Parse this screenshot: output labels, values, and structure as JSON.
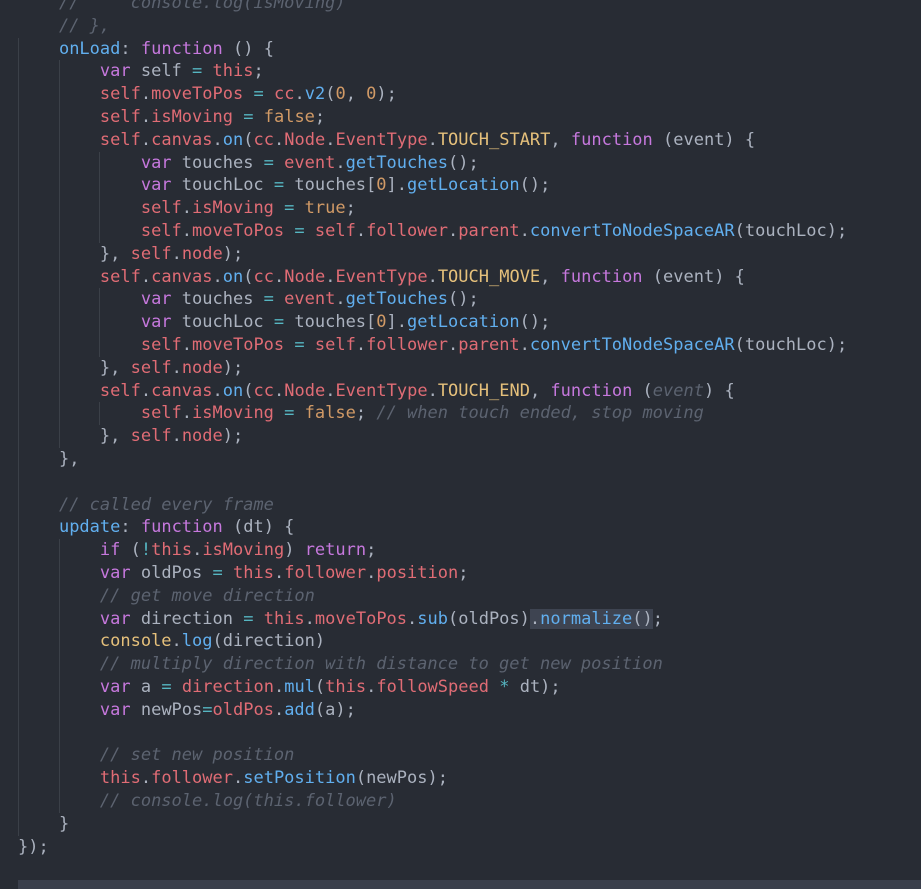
{
  "editor": {
    "lines": [
      [
        [
          "cmt",
          "//     console.log(isMoving)"
        ]
      ],
      [
        [
          "cmt",
          "// },"
        ]
      ],
      [
        [
          "fn",
          "onLoad"
        ],
        [
          "p",
          ": "
        ],
        [
          "kw",
          "function"
        ],
        [
          "p",
          " () {"
        ]
      ],
      [
        [
          "kw",
          "var"
        ],
        [
          "p",
          " self "
        ],
        [
          "op",
          "="
        ],
        [
          "p",
          " "
        ],
        [
          "var",
          "this"
        ],
        [
          "p",
          ";"
        ]
      ],
      [
        [
          "var",
          "self"
        ],
        [
          "p",
          "."
        ],
        [
          "var",
          "moveToPos"
        ],
        [
          "p",
          " "
        ],
        [
          "op",
          "="
        ],
        [
          "p",
          " "
        ],
        [
          "var",
          "cc"
        ],
        [
          "p",
          "."
        ],
        [
          "fn",
          "v2"
        ],
        [
          "p",
          "("
        ],
        [
          "num",
          "0"
        ],
        [
          "p",
          ", "
        ],
        [
          "num",
          "0"
        ],
        [
          "p",
          ");"
        ]
      ],
      [
        [
          "var",
          "self"
        ],
        [
          "p",
          "."
        ],
        [
          "var",
          "isMoving"
        ],
        [
          "p",
          " "
        ],
        [
          "op",
          "="
        ],
        [
          "p",
          " "
        ],
        [
          "num",
          "false"
        ],
        [
          "p",
          ";"
        ]
      ],
      [
        [
          "var",
          "self"
        ],
        [
          "p",
          "."
        ],
        [
          "var",
          "canvas"
        ],
        [
          "p",
          "."
        ],
        [
          "fn",
          "on"
        ],
        [
          "p",
          "("
        ],
        [
          "var",
          "cc"
        ],
        [
          "p",
          "."
        ],
        [
          "var",
          "Node"
        ],
        [
          "p",
          "."
        ],
        [
          "var",
          "EventType"
        ],
        [
          "p",
          "."
        ],
        [
          "obj",
          "TOUCH_START"
        ],
        [
          "p",
          ", "
        ],
        [
          "kw",
          "function"
        ],
        [
          "p",
          " (event) {"
        ]
      ],
      [
        [
          "kw",
          "var"
        ],
        [
          "p",
          " touches "
        ],
        [
          "op",
          "="
        ],
        [
          "p",
          " "
        ],
        [
          "var",
          "event"
        ],
        [
          "p",
          "."
        ],
        [
          "fn",
          "getTouches"
        ],
        [
          "p",
          "();"
        ]
      ],
      [
        [
          "kw",
          "var"
        ],
        [
          "p",
          " touchLoc "
        ],
        [
          "op",
          "="
        ],
        [
          "p",
          " touches["
        ],
        [
          "num",
          "0"
        ],
        [
          "p",
          "]."
        ],
        [
          "fn",
          "getLocation"
        ],
        [
          "p",
          "();"
        ]
      ],
      [
        [
          "var",
          "self"
        ],
        [
          "p",
          "."
        ],
        [
          "var",
          "isMoving"
        ],
        [
          "p",
          " "
        ],
        [
          "op",
          "="
        ],
        [
          "p",
          " "
        ],
        [
          "num",
          "true"
        ],
        [
          "p",
          ";"
        ]
      ],
      [
        [
          "var",
          "self"
        ],
        [
          "p",
          "."
        ],
        [
          "var",
          "moveToPos"
        ],
        [
          "p",
          " "
        ],
        [
          "op",
          "="
        ],
        [
          "p",
          " "
        ],
        [
          "var",
          "self"
        ],
        [
          "p",
          "."
        ],
        [
          "var",
          "follower"
        ],
        [
          "p",
          "."
        ],
        [
          "var",
          "parent"
        ],
        [
          "p",
          "."
        ],
        [
          "fn",
          "convertToNodeSpaceAR"
        ],
        [
          "p",
          "(touchLoc);"
        ]
      ],
      [
        [
          "p",
          "}, "
        ],
        [
          "var",
          "self"
        ],
        [
          "p",
          "."
        ],
        [
          "var",
          "node"
        ],
        [
          "p",
          ");"
        ]
      ],
      [
        [
          "var",
          "self"
        ],
        [
          "p",
          "."
        ],
        [
          "var",
          "canvas"
        ],
        [
          "p",
          "."
        ],
        [
          "fn",
          "on"
        ],
        [
          "p",
          "("
        ],
        [
          "var",
          "cc"
        ],
        [
          "p",
          "."
        ],
        [
          "var",
          "Node"
        ],
        [
          "p",
          "."
        ],
        [
          "var",
          "EventType"
        ],
        [
          "p",
          "."
        ],
        [
          "obj",
          "TOUCH_MOVE"
        ],
        [
          "p",
          ", "
        ],
        [
          "kw",
          "function"
        ],
        [
          "p",
          " (event) {"
        ]
      ],
      [
        [
          "kw",
          "var"
        ],
        [
          "p",
          " touches "
        ],
        [
          "op",
          "="
        ],
        [
          "p",
          " "
        ],
        [
          "var",
          "event"
        ],
        [
          "p",
          "."
        ],
        [
          "fn",
          "getTouches"
        ],
        [
          "p",
          "();"
        ]
      ],
      [
        [
          "kw",
          "var"
        ],
        [
          "p",
          " touchLoc "
        ],
        [
          "op",
          "="
        ],
        [
          "p",
          " touches["
        ],
        [
          "num",
          "0"
        ],
        [
          "p",
          "]."
        ],
        [
          "fn",
          "getLocation"
        ],
        [
          "p",
          "();"
        ]
      ],
      [
        [
          "var",
          "self"
        ],
        [
          "p",
          "."
        ],
        [
          "var",
          "moveToPos"
        ],
        [
          "p",
          " "
        ],
        [
          "op",
          "="
        ],
        [
          "p",
          " "
        ],
        [
          "var",
          "self"
        ],
        [
          "p",
          "."
        ],
        [
          "var",
          "follower"
        ],
        [
          "p",
          "."
        ],
        [
          "var",
          "parent"
        ],
        [
          "p",
          "."
        ],
        [
          "fn",
          "convertToNodeSpaceAR"
        ],
        [
          "p",
          "(touchLoc);"
        ]
      ],
      [
        [
          "p",
          "}, "
        ],
        [
          "var",
          "self"
        ],
        [
          "p",
          "."
        ],
        [
          "var",
          "node"
        ],
        [
          "p",
          ");"
        ]
      ],
      [
        [
          "var",
          "self"
        ],
        [
          "p",
          "."
        ],
        [
          "var",
          "canvas"
        ],
        [
          "p",
          "."
        ],
        [
          "fn",
          "on"
        ],
        [
          "p",
          "("
        ],
        [
          "var",
          "cc"
        ],
        [
          "p",
          "."
        ],
        [
          "var",
          "Node"
        ],
        [
          "p",
          "."
        ],
        [
          "var",
          "EventType"
        ],
        [
          "p",
          "."
        ],
        [
          "obj",
          "TOUCH_END"
        ],
        [
          "p",
          ", "
        ],
        [
          "kw",
          "function"
        ],
        [
          "p",
          " ("
        ],
        [
          "cmt",
          "event"
        ],
        [
          "p",
          ") {"
        ]
      ],
      [
        [
          "var",
          "self"
        ],
        [
          "p",
          "."
        ],
        [
          "var",
          "isMoving"
        ],
        [
          "p",
          " "
        ],
        [
          "op",
          "="
        ],
        [
          "p",
          " "
        ],
        [
          "num",
          "false"
        ],
        [
          "p",
          "; "
        ],
        [
          "cmt",
          "// when touch ended, stop moving"
        ]
      ],
      [
        [
          "p",
          "}, "
        ],
        [
          "var",
          "self"
        ],
        [
          "p",
          "."
        ],
        [
          "var",
          "node"
        ],
        [
          "p",
          ");"
        ]
      ],
      [
        [
          "p",
          "},"
        ]
      ],
      [],
      [
        [
          "cmt",
          "// called every frame"
        ]
      ],
      [
        [
          "fn",
          "update"
        ],
        [
          "p",
          ": "
        ],
        [
          "kw",
          "function"
        ],
        [
          "p",
          " (dt) {"
        ]
      ],
      [
        [
          "kw",
          "if"
        ],
        [
          "p",
          " ("
        ],
        [
          "op",
          "!"
        ],
        [
          "var",
          "this"
        ],
        [
          "p",
          "."
        ],
        [
          "var",
          "isMoving"
        ],
        [
          "p",
          ") "
        ],
        [
          "kw",
          "return"
        ],
        [
          "p",
          ";"
        ]
      ],
      [
        [
          "kw",
          "var"
        ],
        [
          "p",
          " oldPos "
        ],
        [
          "op",
          "="
        ],
        [
          "p",
          " "
        ],
        [
          "var",
          "this"
        ],
        [
          "p",
          "."
        ],
        [
          "var",
          "follower"
        ],
        [
          "p",
          "."
        ],
        [
          "var",
          "position"
        ],
        [
          "p",
          ";"
        ]
      ],
      [
        [
          "cmt",
          "// get move direction"
        ]
      ],
      [
        [
          "kw",
          "var"
        ],
        [
          "p",
          " direction "
        ],
        [
          "op",
          "="
        ],
        [
          "p",
          " "
        ],
        [
          "var",
          "this"
        ],
        [
          "p",
          "."
        ],
        [
          "var",
          "moveToPos"
        ],
        [
          "p",
          "."
        ],
        [
          "fn",
          "sub"
        ],
        [
          "p",
          "(oldPos)"
        ],
        [
          "sel",
          "."
        ],
        [
          "sel_fn",
          "normalize"
        ],
        [
          "sel",
          "()"
        ],
        [
          "p",
          ";"
        ]
      ],
      [
        [
          "obj",
          "console"
        ],
        [
          "p",
          "."
        ],
        [
          "fn",
          "log"
        ],
        [
          "p",
          "(direction)"
        ]
      ],
      [
        [
          "cmt",
          "// multiply direction with distance to get new position"
        ]
      ],
      [
        [
          "kw",
          "var"
        ],
        [
          "p",
          " a "
        ],
        [
          "op",
          "="
        ],
        [
          "p",
          " "
        ],
        [
          "var",
          "direction"
        ],
        [
          "p",
          "."
        ],
        [
          "fn",
          "mul"
        ],
        [
          "p",
          "("
        ],
        [
          "var",
          "this"
        ],
        [
          "p",
          "."
        ],
        [
          "var",
          "followSpeed"
        ],
        [
          "p",
          " "
        ],
        [
          "op",
          "*"
        ],
        [
          "p",
          " dt);"
        ]
      ],
      [
        [
          "kw",
          "var"
        ],
        [
          "p",
          " newPos"
        ],
        [
          "op",
          "="
        ],
        [
          "var",
          "oldPos"
        ],
        [
          "p",
          "."
        ],
        [
          "fn",
          "add"
        ],
        [
          "p",
          "(a);"
        ]
      ],
      [],
      [
        [
          "cmt",
          "// set new position"
        ]
      ],
      [
        [
          "var",
          "this"
        ],
        [
          "p",
          "."
        ],
        [
          "var",
          "follower"
        ],
        [
          "p",
          "."
        ],
        [
          "fn",
          "setPosition"
        ],
        [
          "p",
          "(newPos);"
        ]
      ],
      [
        [
          "cmt",
          "// console.log(this.follower)"
        ]
      ],
      [
        [
          "p",
          "}"
        ]
      ],
      [
        [
          "p",
          "});"
        ]
      ]
    ]
  },
  "colors": {
    "background": "#282c34",
    "keyword": "#c678dd",
    "variable": "#e06c75",
    "function": "#61afef",
    "constant": "#e5c07b",
    "number": "#d19a66",
    "comment": "#5c6370",
    "operator": "#56b6c2",
    "text": "#abb2bf"
  }
}
